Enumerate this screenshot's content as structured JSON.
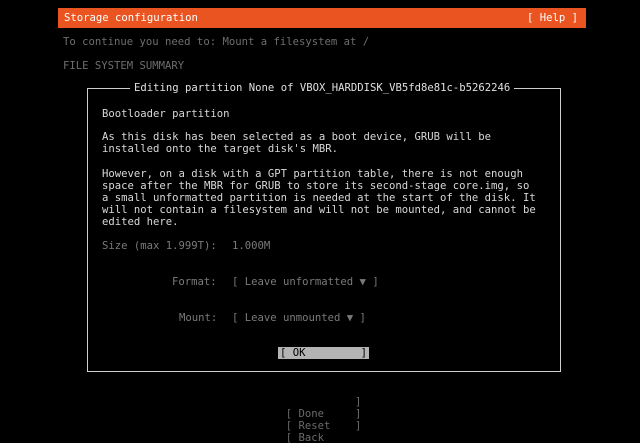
{
  "header": {
    "title": "Storage configuration",
    "help": "[ Help ]"
  },
  "instruction": "To continue you need to: Mount a filesystem at /",
  "summary_heading": "FILE SYSTEM SUMMARY",
  "dialog": {
    "title": "Editing partition None of VBOX_HARDDISK_VB5fd8e81c-b5262246",
    "heading": "Bootloader partition",
    "paragraph1": [
      "As this disk has been selected as a boot device, GRUB will be",
      "installed onto the target disk's MBR."
    ],
    "paragraph2": [
      "However, on a disk with a GPT partition table, there is not enough",
      "space after the MBR for GRUB to store its second-stage core.img, so",
      "a small unformatted partition is needed at the start of the disk. It",
      "will not contain a filesystem and will not be mounted, and cannot be",
      "edited here."
    ],
    "size_label": "Size (max 1.999T):",
    "size_value": "1.000M",
    "format_label": "Format:",
    "format_value": "[ Leave unformatted ▼ ]",
    "mount_label": "Mount:",
    "mount_value": "[ Leave unmounted ▼ ]",
    "ok_open": "[ OK",
    "ok_close": "]"
  },
  "bottom_buttons": [
    {
      "open": "[ Done",
      "close": "]"
    },
    {
      "open": "[ Reset",
      "close": "]"
    },
    {
      "open": "[ Back",
      "close": "]"
    }
  ],
  "colors": {
    "accent": "#e95420",
    "background": "#000000",
    "focused_button": "#b4b4b4"
  }
}
